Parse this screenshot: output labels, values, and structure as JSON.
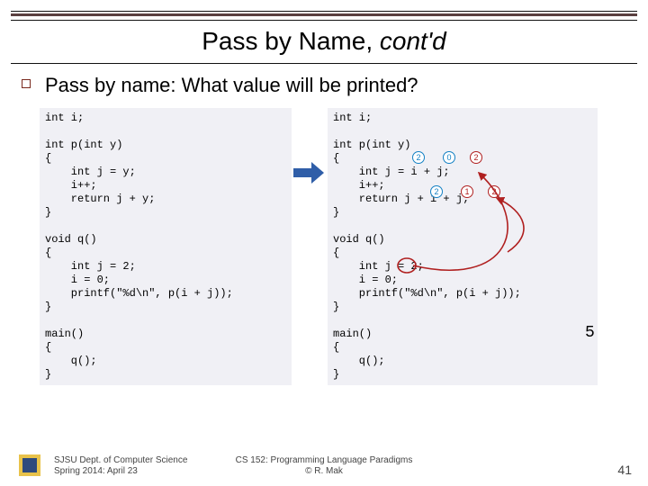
{
  "title_main": "Pass by Name, ",
  "title_cont": "cont'd",
  "subhead": "Pass by name: What value will be printed?",
  "code_left": "int i;\n\nint p(int y)\n{\n    int j = y;\n    i++;\n    return j + y;\n}\n\nvoid q()\n{\n    int j = 2;\n    i = 0;\n    printf(\"%d\\n\", p(i + j));\n}\n\nmain()\n{\n    q();\n}",
  "code_right": "int i;\n\nint p(int y)\n{\n    int j = i + j;\n    i++;\n    return j + i + j;\n}\n\nvoid q()\n{\n    int j = 2;\n    i = 0;\n    printf(\"%d\\n\", p(i + j));\n}\n\nmain()\n{\n    q();\n}",
  "ann": {
    "r1a": "2",
    "r1b": "0",
    "r1c": "2",
    "r2a": "2",
    "r2b": "1",
    "r2c": "2"
  },
  "answer": "5",
  "footer_dept1": "SJSU Dept. of Computer Science",
  "footer_dept2": "Spring 2014: April 23",
  "footer_course1": "CS 152: Programming Language Paradigms",
  "footer_course2": "© R. Mak",
  "page": "41"
}
